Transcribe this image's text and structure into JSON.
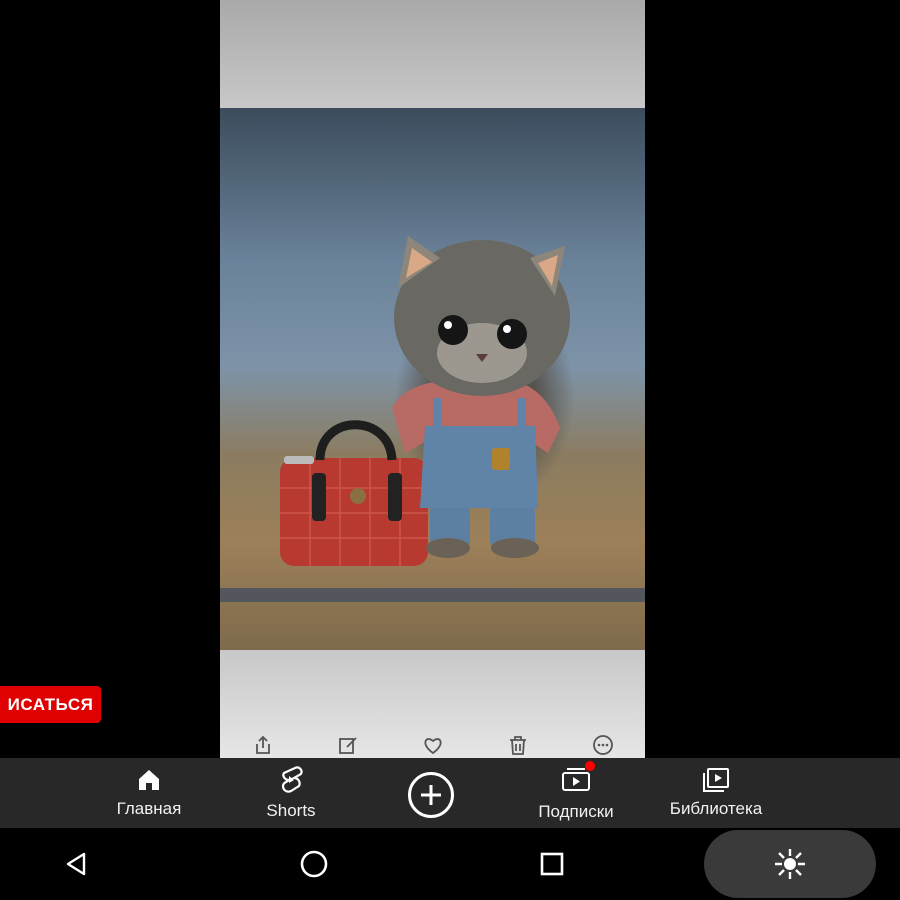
{
  "subscribe_label": "ИСАТЬСЯ",
  "nav": {
    "home_label": "Главная",
    "shorts_label": "Shorts",
    "subscriptions_label": "Подписки",
    "library_label": "Библиотека"
  },
  "action_icons": [
    "share-icon",
    "edit-icon",
    "heart-icon",
    "trash-icon",
    "more-icon"
  ],
  "system_nav_icons": [
    "back-icon",
    "home-circle-icon",
    "recents-icon",
    "accessibility-icon"
  ],
  "colors": {
    "subscribe_bg": "#e00000",
    "notification_dot": "#ff0000",
    "nav_bg": "#282828"
  }
}
